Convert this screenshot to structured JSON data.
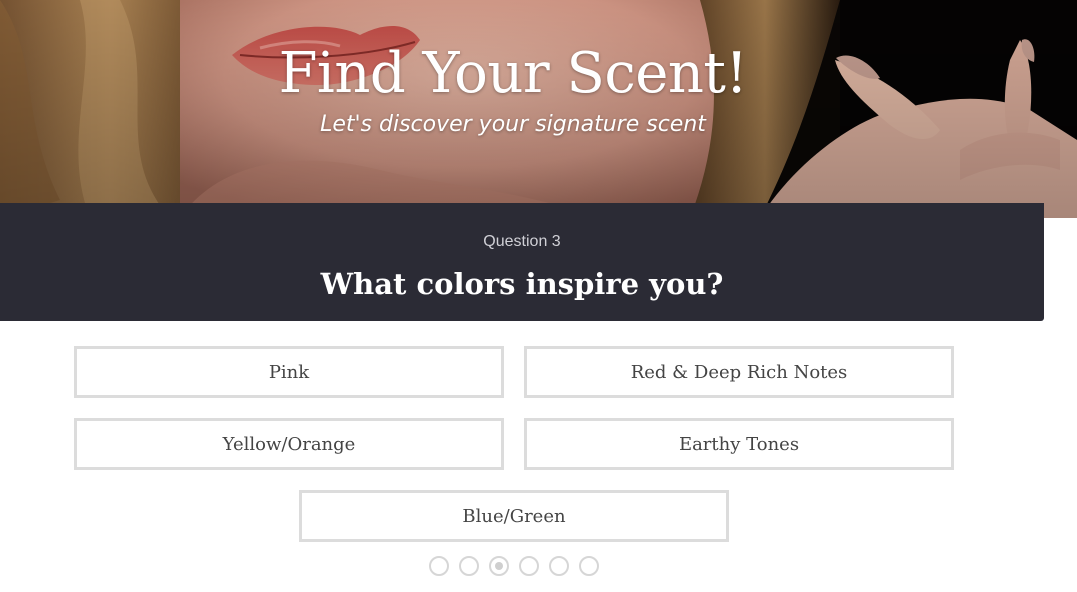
{
  "hero": {
    "title": "Find Your Scent!",
    "subtitle": "Let's discover your signature scent"
  },
  "question": {
    "number_label": "Question 3",
    "text": "What colors inspire you?"
  },
  "answers": [
    {
      "label": "Pink"
    },
    {
      "label": "Red & Deep Rich Notes"
    },
    {
      "label": "Yellow/Orange"
    },
    {
      "label": "Earthy Tones"
    },
    {
      "label": "Blue/Green"
    }
  ],
  "progress": {
    "total_steps": 6,
    "current_step": 3
  },
  "colors": {
    "question_bar": "#2b2b35",
    "answer_border": "#dcdcdc",
    "answer_text": "#444444"
  }
}
